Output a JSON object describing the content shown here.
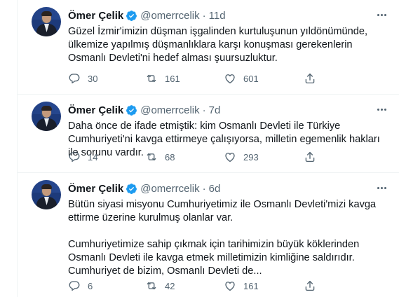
{
  "author": {
    "name": "Ömer Çelik",
    "handle": "@omerrcelik"
  },
  "tweets": [
    {
      "time": "11d",
      "text": "Güzel İzmir'imizin düşman işgalinden kurtuluşunun yıldönümünde, ülkemize yapılmış düşmanlıklara karşı konuşması gerekenlerin Osmanlı Devleti'ni hedef alması şuursuzluktur.",
      "replies": "30",
      "retweets": "161",
      "likes": "601"
    },
    {
      "time": "7d",
      "text": "Daha önce de ifade etmiştik: kim Osmanlı Devleti ile Türkiye Cumhuriyeti'ni kavga ettirmeye çalışıyorsa, milletin egemenlik hakları ile sorunu vardır.",
      "replies": "14",
      "retweets": "68",
      "likes": "293"
    },
    {
      "time": "6d",
      "text": "Bütün siyasi misyonu Cumhuriyetimiz ile Osmanlı Devleti'mizi kavga ettirme üzerine kurulmuş olanlar var.\n\nCumhuriyetimize sahip çıkmak için tarihimizin büyük köklerinden Osmanlı Devleti ile kavga etmek milletimizin kimliğine saldırıdır. Cumhuriyet de bizim, Osmanlı Devleti de...",
      "replies": "6",
      "retweets": "42",
      "likes": "161"
    }
  ],
  "colors": {
    "verified": "#1d9bf0",
    "muted": "#536471",
    "text": "#0f1419",
    "divider": "#eff3f4"
  },
  "icons": [
    "verified-badge-icon",
    "more-icon",
    "reply-icon",
    "retweet-icon",
    "like-icon",
    "share-icon"
  ]
}
